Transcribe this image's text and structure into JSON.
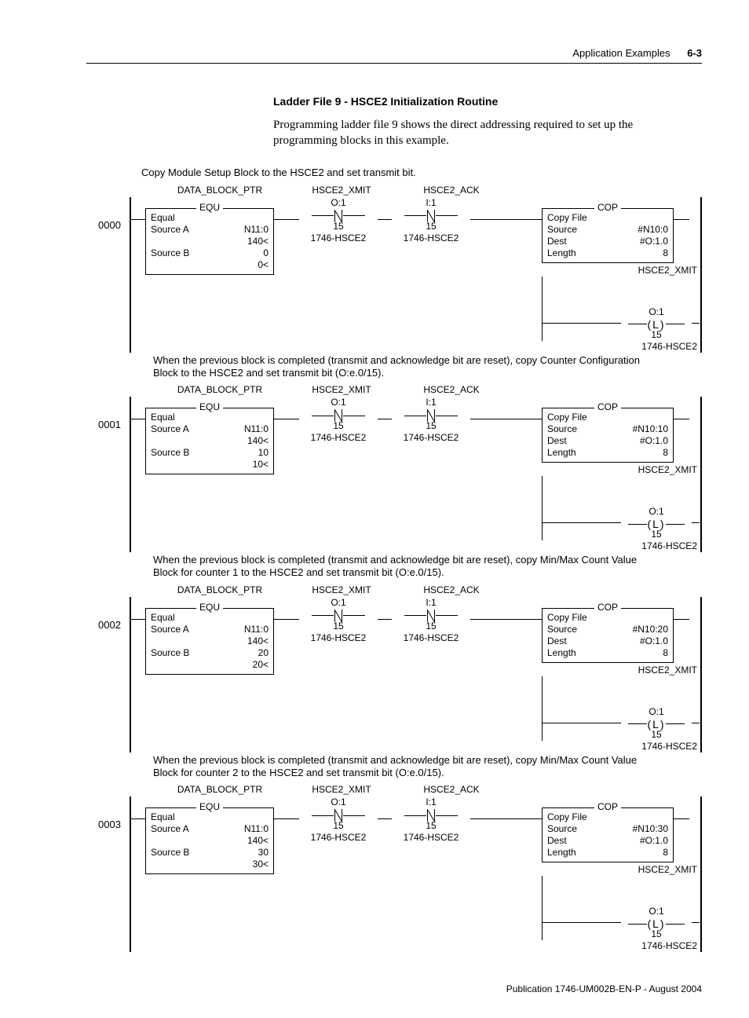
{
  "header": {
    "section": "Application Examples",
    "page": "6-3"
  },
  "title": "Ladder File 9 - HSCE2 Initialization Routine",
  "body": "Programming ladder file 9 shows the direct addressing required to set up the programming blocks in this example.",
  "topcaption": "Copy Module Setup Block to the HSCE2 and set transmit bit.",
  "footer": "Publication 1746-UM002B-EN-P - August 2004",
  "common": {
    "equ": {
      "label_ptr": "DATA_BLOCK_PTR",
      "box": "EQU",
      "lbl_equal": "Equal",
      "lbl_srcA": "Source A",
      "lbl_srcB": "Source B",
      "srcA_val": "N11:0",
      "srcA_sub": "140<"
    },
    "xmit": {
      "tag": "HSCE2_XMIT",
      "addr": "O:1",
      "bit": "15",
      "chip": "1746-HSCE2"
    },
    "ack": {
      "tag": "HSCE2_ACK",
      "addr": "I:1",
      "bit": "15",
      "chip": "1746-HSCE2"
    },
    "cop": {
      "box": "COP",
      "lbl_cpy": "Copy File",
      "lbl_src": "Source",
      "lbl_dst": "Dest",
      "lbl_len": "Length",
      "dst": "#O:1.0",
      "len": "8"
    },
    "coil": {
      "tag": "HSCE2_XMIT",
      "addr": "O:1",
      "letter": "L",
      "bit": "15",
      "chip": "1746-HSCE2"
    }
  },
  "rungs": [
    {
      "num": "0000",
      "comment": "",
      "srcB": "0",
      "srcB_sub": "0<",
      "cop_src": "#N10:0"
    },
    {
      "num": "0001",
      "comment": "When the previous block is completed (transmit and acknowledge bit are reset), copy Counter Configuration Block to the HSCE2 and set transmit bit (O:e.0/15).",
      "srcB": "10",
      "srcB_sub": "10<",
      "cop_src": "#N10:10"
    },
    {
      "num": "0002",
      "comment": "When the previous block is completed (transmit and acknowledge bit are reset), copy Min/Max Count Value Block for counter 1 to the HSCE2 and set transmit bit (O:e.0/15).",
      "srcB": "20",
      "srcB_sub": "20<",
      "cop_src": "#N10:20"
    },
    {
      "num": "0003",
      "comment": "When the previous block is completed (transmit and acknowledge bit are reset), copy Min/Max Count Value Block for counter 2 to the HSCE2 and set transmit bit (O:e.0/15).",
      "srcB": "30",
      "srcB_sub": "30<",
      "cop_src": "#N10:30"
    }
  ]
}
